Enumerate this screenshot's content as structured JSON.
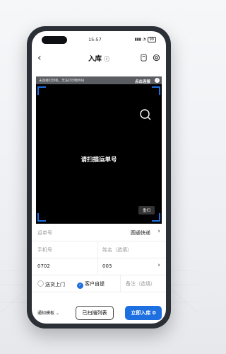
{
  "status_bar": {
    "time": "15:57",
    "battery": "99"
  },
  "nav": {
    "title": "入库"
  },
  "printer": {
    "message": "未连接打印机，无法打印物件码",
    "action": "点击连接"
  },
  "scanner": {
    "prompt": "请扫描运单号",
    "rescan": "重扫"
  },
  "form": {
    "waybill_placeholder": "运单号",
    "courier": "圆通快递",
    "phone_placeholder": "手机号",
    "name_placeholder": "姓名（选填）",
    "phone_value": "0702",
    "code_value": "003",
    "option_delivery": "送货上门",
    "option_pickup": "客户自提",
    "remark_placeholder": "备注（选填）"
  },
  "footer": {
    "template": "通知模板",
    "scan_list": "已扫描列表",
    "confirm": "立即入库",
    "count": "0"
  },
  "colors": {
    "accent": "#1e6fe0"
  }
}
